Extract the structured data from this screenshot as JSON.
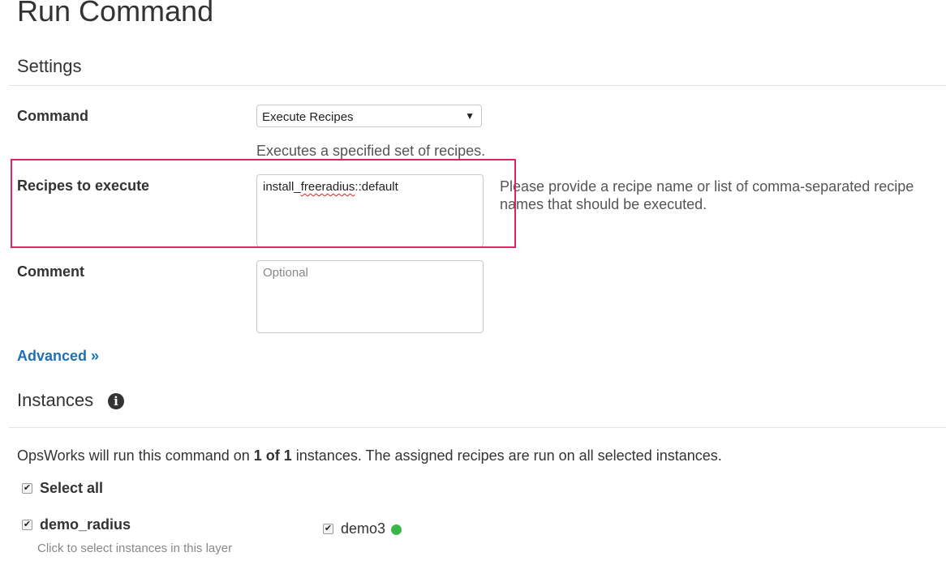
{
  "page": {
    "title": "Run Command"
  },
  "settings": {
    "title": "Settings",
    "command": {
      "label": "Command",
      "selected": "Execute Recipes",
      "description": "Executes a specified set of recipes."
    },
    "recipes": {
      "label": "Recipes to execute",
      "value_prefix": "install_",
      "value_misspelled": "freeradius",
      "value_suffix": "::default",
      "help": "Please provide a recipe name or list of comma-separated recipe names that should be executed."
    },
    "comment": {
      "label": "Comment",
      "placeholder": "Optional"
    },
    "advanced_link": "Advanced »"
  },
  "instances": {
    "title": "Instances",
    "summary_prefix": "OpsWorks will run this command on ",
    "summary_count": "1 of 1",
    "summary_suffix": " instances. The assigned recipes are run on all selected instances.",
    "select_all_label": "Select all",
    "layers": [
      {
        "name": "demo_radius",
        "hint": "Click to select instances in this layer",
        "checked": true,
        "instances": [
          {
            "name": "demo3",
            "checked": true,
            "status_color": "#3bb54a"
          }
        ]
      }
    ]
  },
  "colors": {
    "accent_link": "#1f6fb7",
    "highlight_border": "#e0245e",
    "status_online": "#3bb54a"
  },
  "icons": {
    "info": "info-icon",
    "check": "checkmark",
    "dropdown": "caret-down-icon"
  }
}
